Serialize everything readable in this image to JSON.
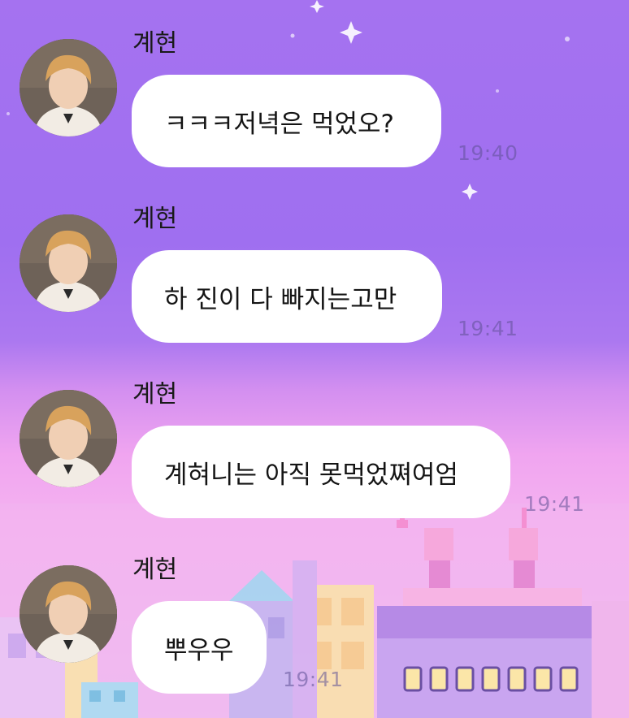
{
  "messages": [
    {
      "sender": "계현",
      "text": "ㅋㅋㅋ저녁은 먹었오?",
      "time": "19:40"
    },
    {
      "sender": "계현",
      "text": "하 진이 다 빠지는고만",
      "time": "19:41"
    },
    {
      "sender": "계현",
      "text": "계혀니는 아직 못먹었쪄여엄",
      "time": "19:41"
    },
    {
      "sender": "계현",
      "text": "뿌우우",
      "time": "19:41"
    }
  ],
  "colors": {
    "bubble": "#ffffff",
    "sky_top": "#a572f0",
    "sky_bottom": "#f5b3f0",
    "timestamp": "#8c7bb8"
  }
}
